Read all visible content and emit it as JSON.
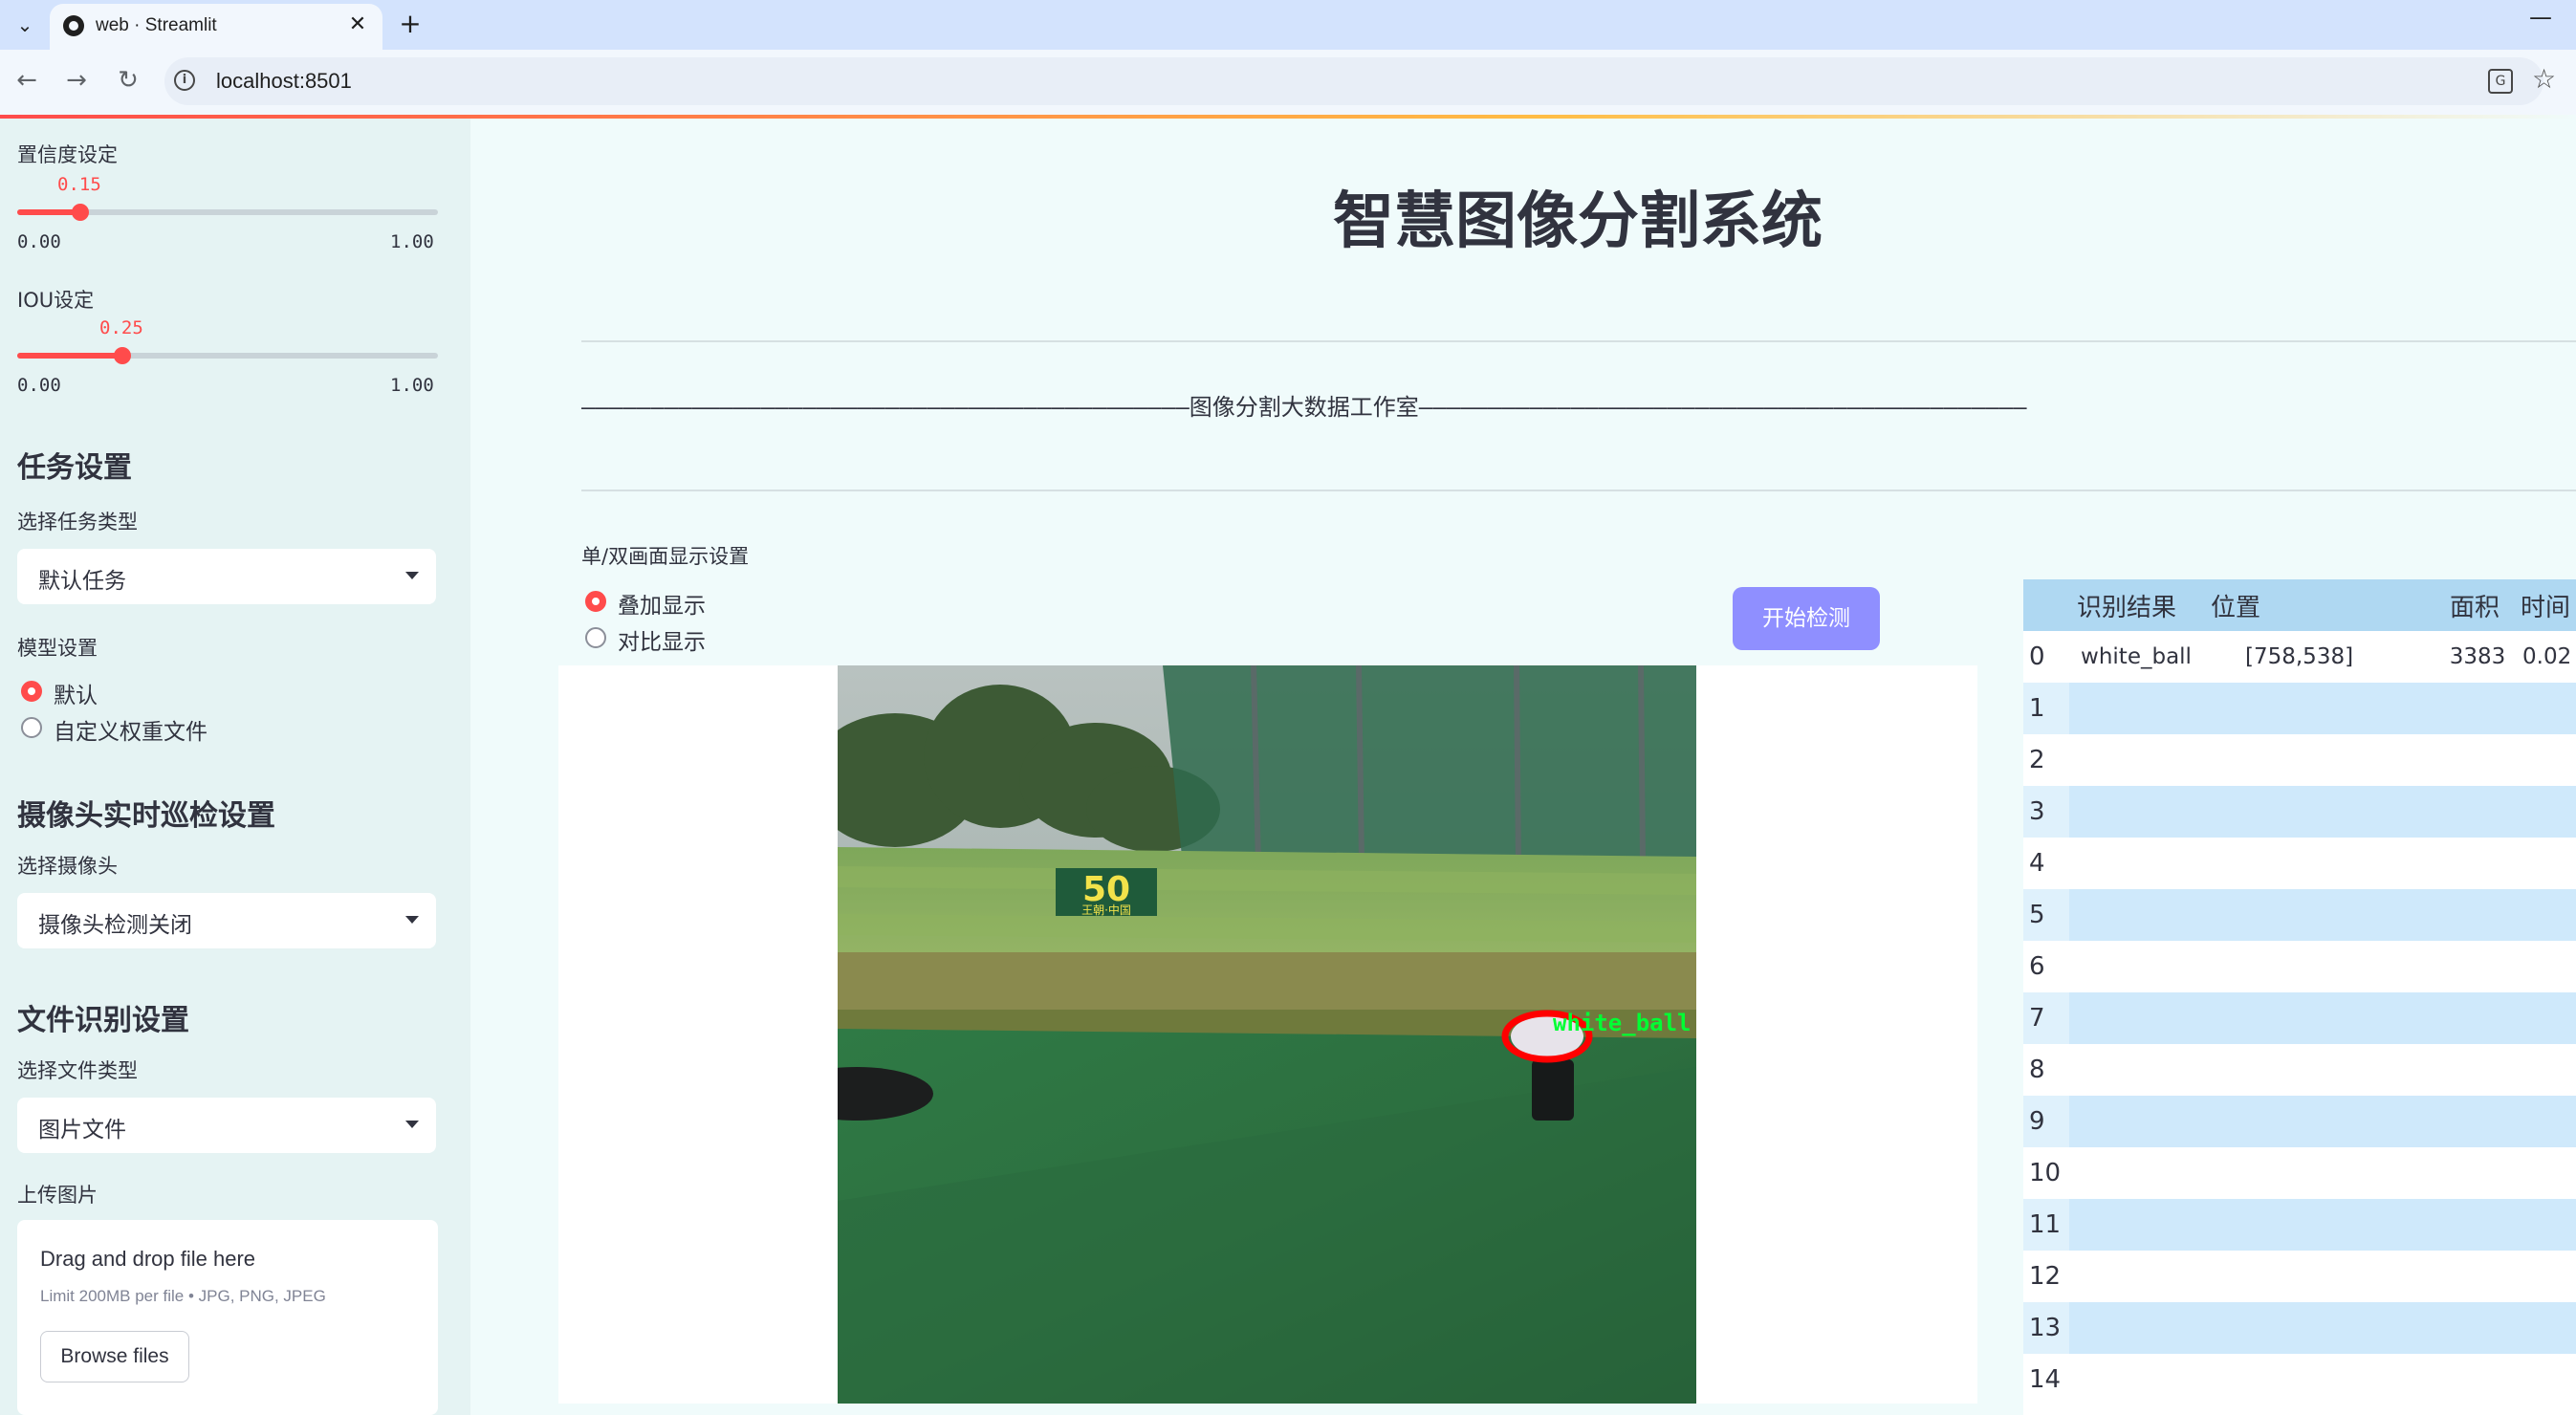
{
  "browser": {
    "tab_title": "web · Streamlit",
    "url": "localhost:8501"
  },
  "sidebar": {
    "confidence": {
      "label": "置信度设定",
      "value_text": "0.15",
      "min": "0.00",
      "max": "1.00",
      "value": 0.15
    },
    "iou": {
      "label": "IOU设定",
      "value_text": "0.25",
      "min": "0.00",
      "max": "1.00",
      "value": 0.25
    },
    "task": {
      "heading": "任务设置",
      "select_label": "选择任务类型",
      "selected": "默认任务"
    },
    "model": {
      "label": "模型设置",
      "options": [
        "默认",
        "自定义权重文件"
      ],
      "selected_index": 0
    },
    "camera": {
      "heading": "摄像头实时巡检设置",
      "select_label": "选择摄像头",
      "selected": "摄像头检测关闭"
    },
    "file": {
      "heading": "文件识别设置",
      "select_label": "选择文件类型",
      "selected": "图片文件",
      "upload_label": "上传图片"
    },
    "uploader": {
      "title": "Drag and drop file here",
      "limit": "Limit 200MB per file • JPG, PNG, JPEG",
      "button": "Browse files"
    }
  },
  "main": {
    "title": "智慧图像分割系统",
    "divider_text": "————————————————————————————————————————————图像分割大数据工作室————————————————————————————————————————————",
    "display_mode": {
      "label": "单/双画面显示设置",
      "options": [
        "叠加显示",
        "对比显示"
      ],
      "selected_index": 0
    },
    "start_button": "开始检测",
    "scene": {
      "sign_number": "50",
      "sign_text": "王朝·中国",
      "detection_label": "white_ball"
    }
  },
  "results": {
    "columns": [
      "识别结果",
      "位置",
      "面积",
      "时间"
    ],
    "rows": [
      {
        "index": "0",
        "label": "white_ball",
        "position": "[758,538]",
        "area": "3383",
        "time": "0.02"
      },
      {
        "index": "1"
      },
      {
        "index": "2"
      },
      {
        "index": "3"
      },
      {
        "index": "4"
      },
      {
        "index": "5"
      },
      {
        "index": "6"
      },
      {
        "index": "7"
      },
      {
        "index": "8"
      },
      {
        "index": "9"
      },
      {
        "index": "10"
      },
      {
        "index": "11"
      },
      {
        "index": "12"
      },
      {
        "index": "13"
      },
      {
        "index": "14"
      }
    ]
  },
  "colors": {
    "accent": "#ff4b4b",
    "button": "#8f8fff",
    "table_header": "#afd8f2",
    "table_stripe": "#cfe9fb",
    "detection_outline": "#ff0000",
    "detection_text": "#00ff33"
  },
  "icons": [
    "tab-list-icon",
    "close-icon",
    "plus-icon",
    "minimize-icon",
    "back-arrow-icon",
    "forward-arrow-icon",
    "reload-icon",
    "info-icon",
    "translate-icon",
    "star-icon",
    "chevron-down-icon"
  ]
}
